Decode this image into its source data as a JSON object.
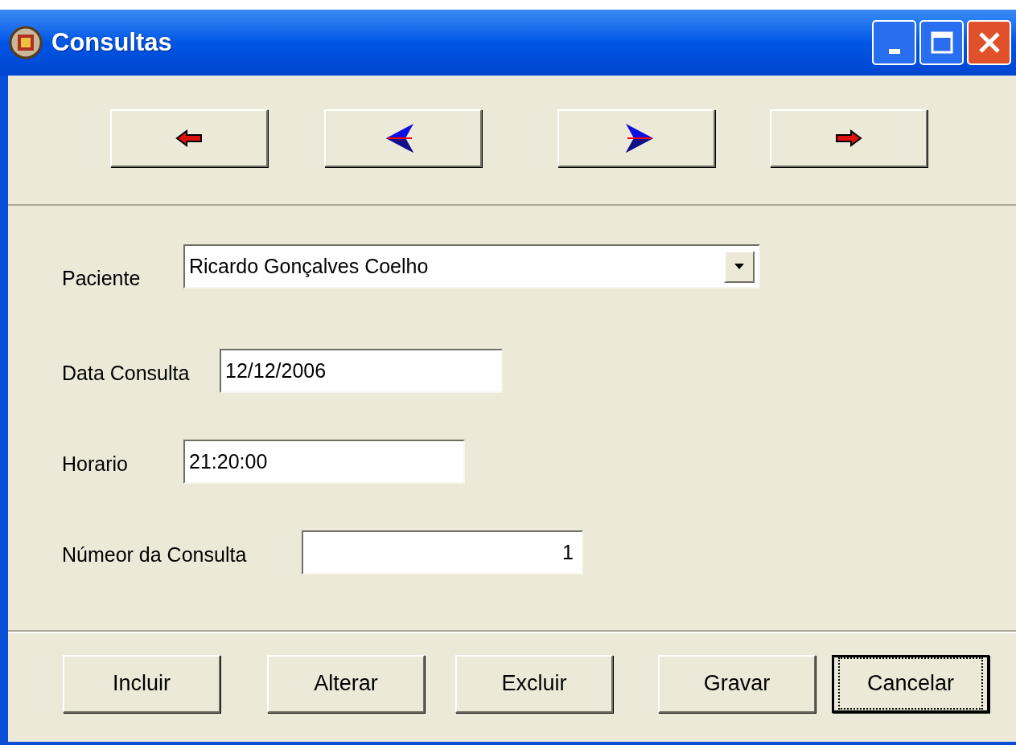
{
  "window": {
    "title": "Consultas"
  },
  "nav_buttons": [
    {
      "kind": "first"
    },
    {
      "kind": "prior"
    },
    {
      "kind": "next"
    },
    {
      "kind": "last"
    }
  ],
  "fields": [
    {
      "kind": "combo",
      "label": "Paciente",
      "value": "Ricardo Gonçalves Coelho"
    },
    {
      "kind": "text",
      "label": "Data Consulta",
      "value": "12/12/2006"
    },
    {
      "kind": "text",
      "label": "Horario",
      "value": "21:20:00"
    },
    {
      "kind": "number",
      "label": "Númeor da Consulta",
      "value": "1"
    }
  ],
  "buttons": [
    {
      "label": "Incluir",
      "focused": false
    },
    {
      "label": "Alterar",
      "focused": false
    },
    {
      "label": "Excluir",
      "focused": false
    },
    {
      "label": "Gravar",
      "focused": false
    },
    {
      "label": "Cancelar",
      "focused": true
    }
  ]
}
